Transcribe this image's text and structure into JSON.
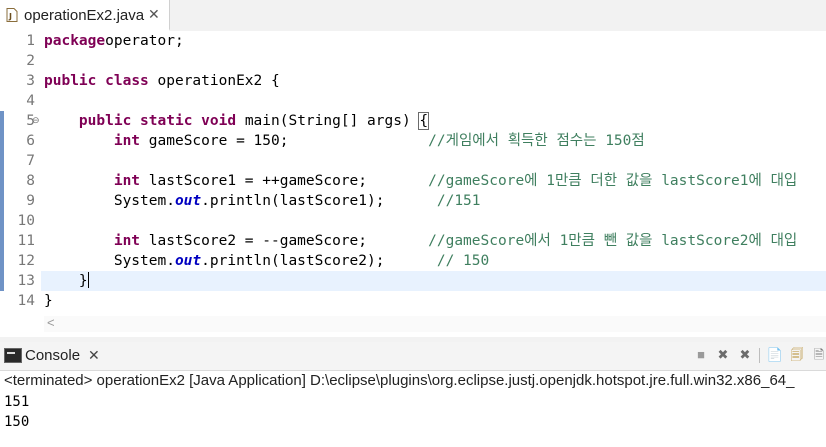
{
  "tab": {
    "title": "operationEx2.java",
    "close": "✕"
  },
  "editor": {
    "lines": [
      {
        "n": "1",
        "fold": "",
        "segs": [
          [
            "kw",
            "package"
          ],
          [
            "",
            "operator;"
          ]
        ]
      },
      {
        "n": "2",
        "fold": "",
        "segs": []
      },
      {
        "n": "3",
        "fold": "",
        "segs": [
          [
            "kw",
            "public"
          ],
          [
            "",
            " "
          ],
          [
            "kw",
            "class"
          ],
          [
            "",
            " operationEx2 {"
          ]
        ]
      },
      {
        "n": "4",
        "fold": "",
        "segs": []
      },
      {
        "n": "5",
        "fold": "⊖",
        "segs": [
          [
            "",
            "    "
          ],
          [
            "kw",
            "public"
          ],
          [
            "",
            " "
          ],
          [
            "kw",
            "static"
          ],
          [
            "",
            " "
          ],
          [
            "kw",
            "void"
          ],
          [
            "",
            " main(String[] args) "
          ],
          [
            "brace",
            "{"
          ]
        ]
      },
      {
        "n": "6",
        "fold": "",
        "segs": [
          [
            "",
            "        "
          ],
          [
            "kw",
            "int"
          ],
          [
            "",
            " gameScore = 150;                "
          ],
          [
            "cm",
            "//게임에서 획득한 점수는 150점"
          ]
        ]
      },
      {
        "n": "7",
        "fold": "",
        "segs": []
      },
      {
        "n": "8",
        "fold": "",
        "segs": [
          [
            "",
            "        "
          ],
          [
            "kw",
            "int"
          ],
          [
            "",
            " lastScore1 = ++gameScore;       "
          ],
          [
            "cm",
            "//gameScore에 1만큼 더한 값을 lastScore1에 대입"
          ]
        ]
      },
      {
        "n": "9",
        "fold": "",
        "segs": [
          [
            "",
            "        System."
          ],
          [
            "fs",
            "out"
          ],
          [
            "",
            ".println(lastScore1);      "
          ],
          [
            "cm",
            "//151"
          ]
        ]
      },
      {
        "n": "10",
        "fold": "",
        "segs": []
      },
      {
        "n": "11",
        "fold": "",
        "segs": [
          [
            "",
            "        "
          ],
          [
            "kw",
            "int"
          ],
          [
            "",
            " lastScore2 = --gameScore;       "
          ],
          [
            "cm",
            "//gameScore에서 1만큼 뺀 값을 lastScore2에 대입"
          ]
        ]
      },
      {
        "n": "12",
        "fold": "",
        "segs": [
          [
            "",
            "        System."
          ],
          [
            "fs",
            "out"
          ],
          [
            "",
            ".println(lastScore2);      "
          ],
          [
            "cm",
            "// 150"
          ]
        ]
      },
      {
        "n": "13",
        "fold": "",
        "segs": [
          [
            "",
            "    }"
          ],
          [
            "caret",
            ""
          ]
        ]
      },
      {
        "n": "14",
        "fold": "",
        "segs": [
          [
            "",
            "}"
          ]
        ]
      }
    ],
    "current_line": 13,
    "scroll_left_arrow": "<"
  },
  "console": {
    "title": "Console",
    "close": "✕",
    "toolbar": [
      {
        "icon": "terminate-icon",
        "glyph": "■"
      },
      {
        "icon": "remove-launch-icon",
        "glyph": "✖"
      },
      {
        "icon": "remove-all-icon",
        "glyph": "✖"
      },
      {
        "icon": "clear-console-icon",
        "glyph": "📄"
      },
      {
        "icon": "scroll-lock-icon",
        "glyph": "🗐"
      },
      {
        "icon": "word-wrap-icon",
        "glyph": "🗎"
      }
    ],
    "terminated": "<terminated> operationEx2 [Java Application] D:\\eclipse\\plugins\\org.eclipse.justj.openjdk.hotspot.jre.full.win32.x86_64_",
    "output": [
      "151",
      "150"
    ]
  }
}
